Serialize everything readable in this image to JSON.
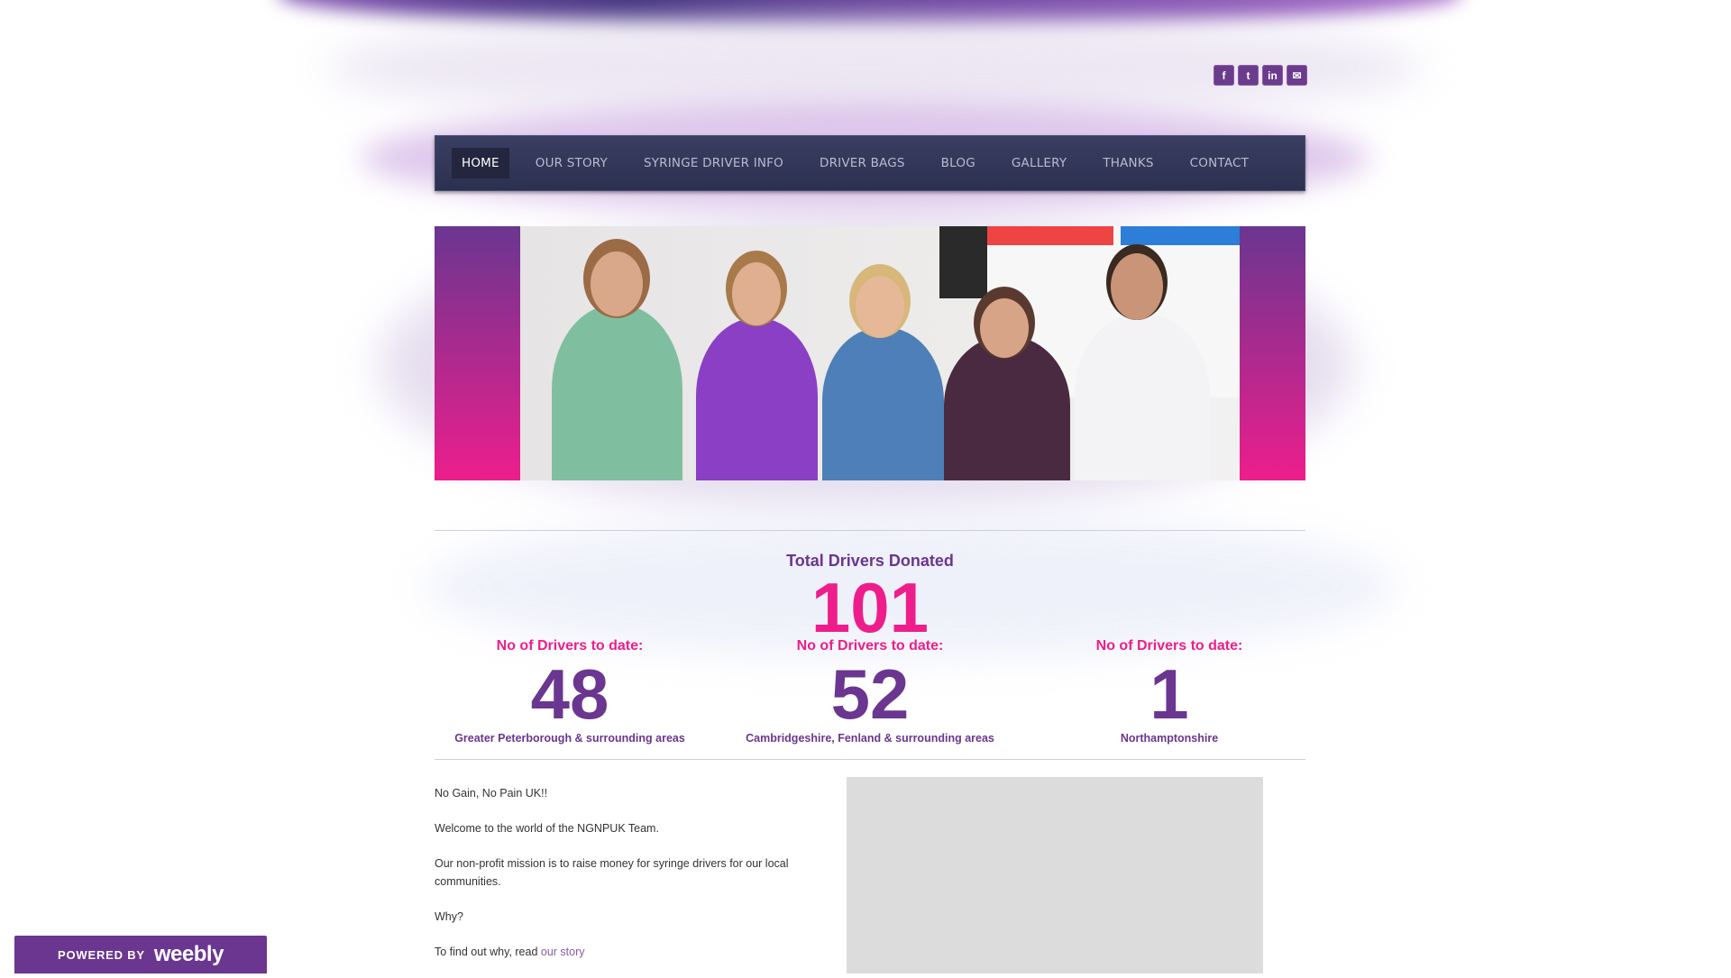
{
  "social": {
    "icons": [
      {
        "name": "facebook-icon",
        "glyph": "f"
      },
      {
        "name": "twitter-icon",
        "glyph": "t"
      },
      {
        "name": "linkedin-icon",
        "glyph": "in"
      },
      {
        "name": "mail-icon",
        "glyph": "✉"
      }
    ]
  },
  "nav": {
    "items": [
      "HOME",
      "OUR STORY",
      "SYRINGE DRIVER INFO",
      "DRIVER BAGS",
      "BLOG",
      "GALLERY",
      "THANKS",
      "CONTACT"
    ],
    "active": "HOME"
  },
  "banner": {
    "colors": {
      "top": "#6a3690",
      "bottom": "#ed1e8c"
    }
  },
  "stats": {
    "total_title": "Total Drivers Donated",
    "total_value": "101",
    "regions": [
      {
        "label": "No of Drivers to date:",
        "value": "48",
        "area": "Greater Peterborough & surrounding areas"
      },
      {
        "label": "No of Drivers to date:",
        "value": "52",
        "area": "Cambridgeshire, Fenland & surrounding areas"
      },
      {
        "label": "No of Drivers to date:",
        "value": "1",
        "area": "Northamptonshire"
      }
    ]
  },
  "content": {
    "p1": "No Gain, No Pain UK!!",
    "p2": "Welcome to the world of the NGNPUK Team.",
    "p3": "Our non-profit mission is to raise money for syringe drivers for our local communities.",
    "p4": "Why?",
    "p5_prefix": "To find out why, read ",
    "p5_link": "our story"
  },
  "footer_badge": {
    "powered": "POWERED BY",
    "brand": "weebly"
  },
  "colors": {
    "accent_purple": "#6a3690",
    "accent_pink": "#ed1e8c",
    "nav_bg": "#2c3050"
  }
}
